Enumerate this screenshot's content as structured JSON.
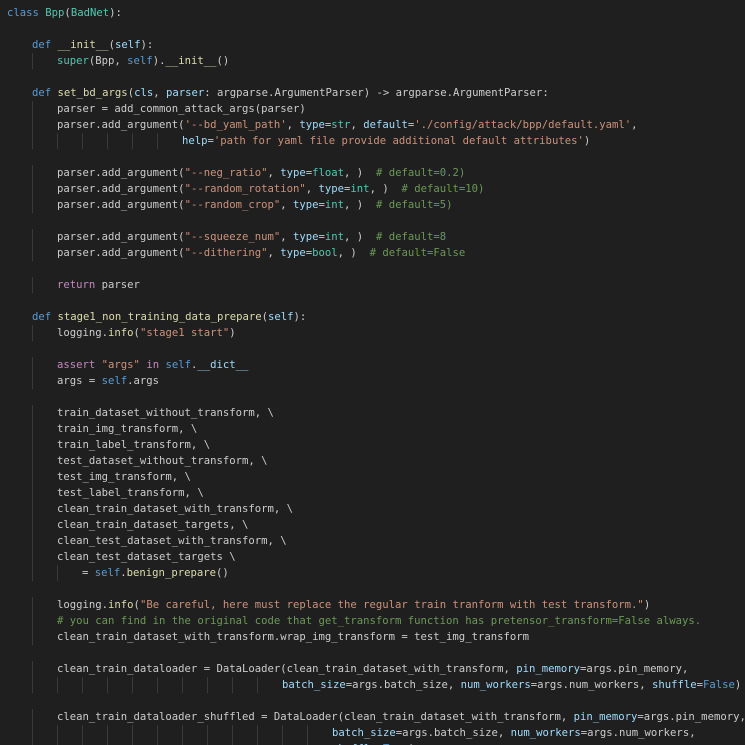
{
  "editor": {
    "language": "python",
    "colors": {
      "background": "#1f1f1f",
      "plain": "#cccccc",
      "keyword_def": "#569cd6",
      "keyword_control": "#c586c0",
      "function": "#dcdcaa",
      "class": "#4ec9b0",
      "variable": "#9cdcfe",
      "string": "#ce9178",
      "comment": "#6a9955"
    },
    "lines": [
      {
        "indent": 0,
        "tokens": [
          [
            "def",
            "class"
          ],
          [
            "pl",
            " "
          ],
          [
            "cls",
            "Bpp"
          ],
          [
            "pl",
            "("
          ],
          [
            "cls",
            "BadNet"
          ],
          [
            "pl",
            "):"
          ]
        ]
      },
      {
        "indent": 0,
        "tokens": []
      },
      {
        "indent": 1,
        "tokens": [
          [
            "def",
            "def"
          ],
          [
            "pl",
            " "
          ],
          [
            "fn",
            "__init__"
          ],
          [
            "pl",
            "("
          ],
          [
            "var",
            "self"
          ],
          [
            "pl",
            "):"
          ]
        ]
      },
      {
        "indent": 2,
        "tokens": [
          [
            "cls",
            "super"
          ],
          [
            "pl",
            "(Bpp, "
          ],
          [
            "self",
            "self"
          ],
          [
            "pl",
            ")."
          ],
          [
            "fn",
            "__init__"
          ],
          [
            "pl",
            "()"
          ]
        ]
      },
      {
        "indent": 0,
        "tokens": []
      },
      {
        "indent": 1,
        "tokens": [
          [
            "def",
            "def"
          ],
          [
            "pl",
            " "
          ],
          [
            "fn",
            "set_bd_args"
          ],
          [
            "pl",
            "("
          ],
          [
            "var",
            "cls"
          ],
          [
            "pl",
            ", "
          ],
          [
            "var",
            "parser"
          ],
          [
            "pl",
            ": argparse.ArgumentParser) -> argparse.ArgumentParser:"
          ]
        ]
      },
      {
        "indent": 2,
        "tokens": [
          [
            "pl",
            "parser = add_common_attack_args(parser)"
          ]
        ]
      },
      {
        "indent": 2,
        "tokens": [
          [
            "pl",
            "parser.add_argument("
          ],
          [
            "str",
            "'--bd_yaml_path'"
          ],
          [
            "pl",
            ", "
          ],
          [
            "var",
            "type"
          ],
          [
            "pl",
            "="
          ],
          [
            "cls",
            "str"
          ],
          [
            "pl",
            ", "
          ],
          [
            "var",
            "default"
          ],
          [
            "pl",
            "="
          ],
          [
            "str",
            "'./config/attack/bpp/default.yaml'"
          ],
          [
            "pl",
            ","
          ]
        ]
      },
      {
        "indent": 7,
        "tokens": [
          [
            "var",
            "help"
          ],
          [
            "pl",
            "="
          ],
          [
            "str",
            "'path for yaml file provide additional default attributes'"
          ],
          [
            "pl",
            ")"
          ]
        ]
      },
      {
        "indent": 0,
        "tokens": []
      },
      {
        "indent": 2,
        "tokens": [
          [
            "pl",
            "parser.add_argument("
          ],
          [
            "str",
            "\"--neg_ratio\""
          ],
          [
            "pl",
            ", "
          ],
          [
            "var",
            "type"
          ],
          [
            "pl",
            "="
          ],
          [
            "cls",
            "float"
          ],
          [
            "pl",
            ", )  "
          ],
          [
            "com",
            "# default=0.2)"
          ]
        ]
      },
      {
        "indent": 2,
        "tokens": [
          [
            "pl",
            "parser.add_argument("
          ],
          [
            "str",
            "\"--random_rotation\""
          ],
          [
            "pl",
            ", "
          ],
          [
            "var",
            "type"
          ],
          [
            "pl",
            "="
          ],
          [
            "cls",
            "int"
          ],
          [
            "pl",
            ", )  "
          ],
          [
            "com",
            "# default=10)"
          ]
        ]
      },
      {
        "indent": 2,
        "tokens": [
          [
            "pl",
            "parser.add_argument("
          ],
          [
            "str",
            "\"--random_crop\""
          ],
          [
            "pl",
            ", "
          ],
          [
            "var",
            "type"
          ],
          [
            "pl",
            "="
          ],
          [
            "cls",
            "int"
          ],
          [
            "pl",
            ", )  "
          ],
          [
            "com",
            "# default=5)"
          ]
        ]
      },
      {
        "indent": 0,
        "tokens": []
      },
      {
        "indent": 2,
        "tokens": [
          [
            "pl",
            "parser.add_argument("
          ],
          [
            "str",
            "\"--squeeze_num\""
          ],
          [
            "pl",
            ", "
          ],
          [
            "var",
            "type"
          ],
          [
            "pl",
            "="
          ],
          [
            "cls",
            "int"
          ],
          [
            "pl",
            ", )  "
          ],
          [
            "com",
            "# default=8"
          ]
        ]
      },
      {
        "indent": 2,
        "tokens": [
          [
            "pl",
            "parser.add_argument("
          ],
          [
            "str",
            "\"--dithering\""
          ],
          [
            "pl",
            ", "
          ],
          [
            "var",
            "type"
          ],
          [
            "pl",
            "="
          ],
          [
            "cls",
            "bool"
          ],
          [
            "pl",
            ", )  "
          ],
          [
            "com",
            "# default=False"
          ]
        ]
      },
      {
        "indent": 0,
        "tokens": []
      },
      {
        "indent": 2,
        "tokens": [
          [
            "kw",
            "return"
          ],
          [
            "pl",
            " parser"
          ]
        ]
      },
      {
        "indent": 0,
        "tokens": []
      },
      {
        "indent": 1,
        "tokens": [
          [
            "def",
            "def"
          ],
          [
            "pl",
            " "
          ],
          [
            "fn",
            "stage1_non_training_data_prepare"
          ],
          [
            "pl",
            "("
          ],
          [
            "var",
            "self"
          ],
          [
            "pl",
            "):"
          ]
        ]
      },
      {
        "indent": 2,
        "tokens": [
          [
            "pl",
            "logging."
          ],
          [
            "fn",
            "info"
          ],
          [
            "pl",
            "("
          ],
          [
            "str",
            "\"stage1 start\""
          ],
          [
            "pl",
            ")"
          ]
        ]
      },
      {
        "indent": 0,
        "tokens": []
      },
      {
        "indent": 2,
        "tokens": [
          [
            "kw",
            "assert"
          ],
          [
            "pl",
            " "
          ],
          [
            "str",
            "\"args\""
          ],
          [
            "pl",
            " "
          ],
          [
            "kw",
            "in"
          ],
          [
            "pl",
            " "
          ],
          [
            "self",
            "self"
          ],
          [
            "pl",
            "."
          ],
          [
            "var",
            "__dict__"
          ]
        ]
      },
      {
        "indent": 2,
        "tokens": [
          [
            "pl",
            "args = "
          ],
          [
            "self",
            "self"
          ],
          [
            "pl",
            ".args"
          ]
        ]
      },
      {
        "indent": 0,
        "tokens": []
      },
      {
        "indent": 2,
        "tokens": [
          [
            "pl",
            "train_dataset_without_transform, \\"
          ]
        ]
      },
      {
        "indent": 2,
        "tokens": [
          [
            "pl",
            "train_img_transform, \\"
          ]
        ]
      },
      {
        "indent": 2,
        "tokens": [
          [
            "pl",
            "train_label_transform, \\"
          ]
        ]
      },
      {
        "indent": 2,
        "tokens": [
          [
            "pl",
            "test_dataset_without_transform, \\"
          ]
        ]
      },
      {
        "indent": 2,
        "tokens": [
          [
            "pl",
            "test_img_transform, \\"
          ]
        ]
      },
      {
        "indent": 2,
        "tokens": [
          [
            "pl",
            "test_label_transform, \\"
          ]
        ]
      },
      {
        "indent": 2,
        "tokens": [
          [
            "pl",
            "clean_train_dataset_with_transform, \\"
          ]
        ]
      },
      {
        "indent": 2,
        "tokens": [
          [
            "pl",
            "clean_train_dataset_targets, \\"
          ]
        ]
      },
      {
        "indent": 2,
        "tokens": [
          [
            "pl",
            "clean_test_dataset_with_transform, \\"
          ]
        ]
      },
      {
        "indent": 2,
        "tokens": [
          [
            "pl",
            "clean_test_dataset_targets \\"
          ]
        ]
      },
      {
        "indent": 3,
        "tokens": [
          [
            "pl",
            "= "
          ],
          [
            "self",
            "self"
          ],
          [
            "pl",
            "."
          ],
          [
            "fn",
            "benign_prepare"
          ],
          [
            "pl",
            "()"
          ]
        ]
      },
      {
        "indent": 0,
        "tokens": []
      },
      {
        "indent": 2,
        "tokens": [
          [
            "pl",
            "logging."
          ],
          [
            "fn",
            "info"
          ],
          [
            "pl",
            "("
          ],
          [
            "str",
            "\"Be careful, here must replace the regular train tranform with test transform.\""
          ],
          [
            "pl",
            ")"
          ]
        ]
      },
      {
        "indent": 2,
        "tokens": [
          [
            "com",
            "# you can find in the original code that get_transform function has pretensor_transform=False always."
          ]
        ]
      },
      {
        "indent": 2,
        "tokens": [
          [
            "pl",
            "clean_train_dataset_with_transform.wrap_img_transform = test_img_transform"
          ]
        ]
      },
      {
        "indent": 0,
        "tokens": []
      },
      {
        "indent": 2,
        "tokens": [
          [
            "pl",
            "clean_train_dataloader = DataLoader(clean_train_dataset_with_transform, "
          ],
          [
            "var",
            "pin_memory"
          ],
          [
            "pl",
            "=args.pin_memory,"
          ]
        ]
      },
      {
        "indent": 11,
        "tokens": [
          [
            "var",
            "batch_size"
          ],
          [
            "pl",
            "=args.batch_size, "
          ],
          [
            "var",
            "num_workers"
          ],
          [
            "pl",
            "=args.num_workers, "
          ],
          [
            "var",
            "shuffle"
          ],
          [
            "pl",
            "="
          ],
          [
            "bool",
            "False"
          ],
          [
            "pl",
            ")"
          ]
        ]
      },
      {
        "indent": 0,
        "tokens": []
      },
      {
        "indent": 2,
        "tokens": [
          [
            "pl",
            "clean_train_dataloader_shuffled = DataLoader(clean_train_dataset_with_transform, "
          ],
          [
            "var",
            "pin_memory"
          ],
          [
            "pl",
            "=args.pin_memory,"
          ]
        ]
      },
      {
        "indent": 13,
        "tokens": [
          [
            "var",
            "batch_size"
          ],
          [
            "pl",
            "=args.batch_size, "
          ],
          [
            "var",
            "num_workers"
          ],
          [
            "pl",
            "=args.num_workers,"
          ]
        ]
      },
      {
        "indent": 13,
        "tokens": [
          [
            "var",
            "shuffle"
          ],
          [
            "pl",
            "="
          ],
          [
            "bool",
            "True"
          ],
          [
            "pl",
            ")"
          ]
        ]
      }
    ]
  }
}
